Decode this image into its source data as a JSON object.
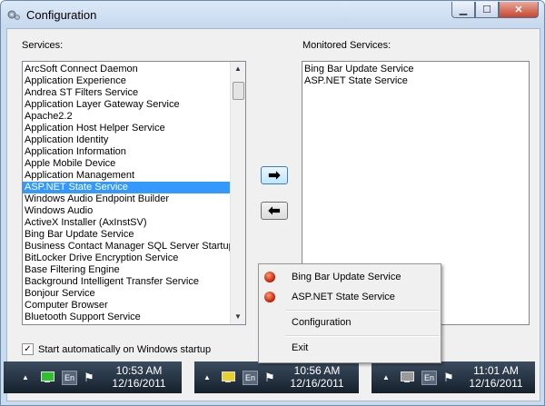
{
  "window": {
    "title": "Configuration",
    "minimize_glyph": "▁",
    "maximize_glyph": "☐",
    "close_glyph": "✕"
  },
  "services": {
    "label": "Services:",
    "items": [
      "ArcSoft Connect Daemon",
      "Application Experience",
      "Andrea ST Filters Service",
      "Application Layer Gateway Service",
      "Apache2.2",
      "Application Host Helper Service",
      "Application Identity",
      "Application Information",
      "Apple Mobile Device",
      "Application Management",
      "ASP.NET State Service",
      "Windows Audio Endpoint Builder",
      "Windows Audio",
      "ActiveX Installer (AxInstSV)",
      "Bing Bar Update Service",
      "Business Contact Manager SQL Server Startup S",
      "BitLocker Drive Encryption Service",
      "Base Filtering Engine",
      "Background Intelligent Transfer Service",
      "Bonjour Service",
      "Computer Browser",
      "Bluetooth Support Service"
    ],
    "selected_index": 10
  },
  "monitored": {
    "label": "Monitored Services:",
    "items": [
      "Bing Bar Update Service",
      "ASP.NET State Service"
    ]
  },
  "buttons": {
    "add_glyph": "➡",
    "remove_glyph": "⬅"
  },
  "startup_checkbox": {
    "label": "Start automatically on Windows startup",
    "checked": true,
    "check_glyph": "✓"
  },
  "context_menu": {
    "items": [
      {
        "label": "Bing Bar Update Service",
        "status_color": "#c01a00"
      },
      {
        "label": "ASP.NET State Service",
        "status_color": "#c01a00"
      },
      {
        "label": "Configuration"
      },
      {
        "label": "Exit"
      }
    ]
  },
  "taskbars": [
    {
      "time": "10:53 AM",
      "date": "12/16/2011",
      "lang": "En",
      "icon_color": "#2fbf2f"
    },
    {
      "time": "10:56 AM",
      "date": "12/16/2011",
      "lang": "En",
      "icon_color": "#e8d22a"
    },
    {
      "time": "11:01 AM",
      "date": "12/16/2011",
      "lang": "En",
      "icon_color": "#9a9a9a"
    }
  ],
  "tray": {
    "show_hidden_glyph": "▲",
    "flag_glyph": "⚑"
  }
}
